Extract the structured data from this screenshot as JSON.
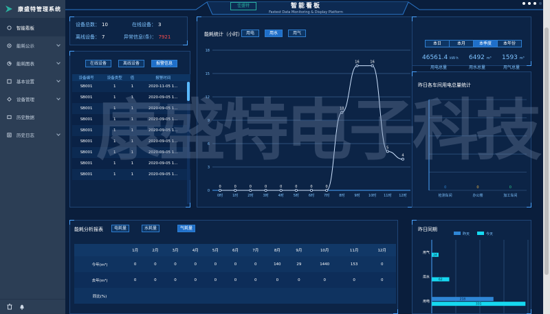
{
  "sidebar": {
    "logo_text": "康盛特管理系统",
    "items": [
      {
        "label": "智能看板",
        "icon": "dashboard-icon",
        "active": true
      },
      {
        "label": "能耗公示",
        "icon": "energy-icon"
      },
      {
        "label": "能耗图表",
        "icon": "chart-icon"
      },
      {
        "label": "基本设置",
        "icon": "settings-icon"
      },
      {
        "label": "设备管理",
        "icon": "device-icon"
      },
      {
        "label": "历史数据",
        "icon": "history-icon"
      },
      {
        "label": "历史日志",
        "icon": "log-icon"
      }
    ]
  },
  "header": {
    "title": "智能看板",
    "subtitle": "Fastest Data Monitoring & Display Platform",
    "logo_text": "佳盛特"
  },
  "device_stats": {
    "total_label": "设备总数：",
    "total_value": "10",
    "online_label": "在线设备：",
    "online_value": "3",
    "offline_label": "离线设备：",
    "offline_value": "7",
    "alarm_label": "异常信息(条)：",
    "alarm_value": "7921"
  },
  "device_panel": {
    "buttons": [
      "在线设备",
      "离线设备",
      "报警信息"
    ],
    "columns": [
      "设备编号",
      "设备类型",
      "值",
      "报警时间"
    ],
    "rows": [
      [
        "SB001",
        "1",
        "1",
        "2020-11-05 1..."
      ],
      [
        "SB001",
        "1",
        "1",
        "2020-09-05 1..."
      ],
      [
        "SB001",
        "1",
        "1",
        "2020-09-05 1..."
      ],
      [
        "SB001",
        "1",
        "1",
        "2020-09-05 1..."
      ],
      [
        "SB001",
        "1",
        "1",
        "2020-09-05 1..."
      ],
      [
        "SB001",
        "1",
        "1",
        "2020-09-05 1..."
      ],
      [
        "SB001",
        "1",
        "1",
        "2020-09-05 1..."
      ],
      [
        "SB001",
        "1",
        "1",
        "2020-09-05 1..."
      ],
      [
        "SB001",
        "1",
        "1",
        "2020-09-05 1..."
      ]
    ]
  },
  "energy_chart": {
    "title": "能耗统计（小时）",
    "tabs": [
      "用电",
      "用水",
      "用气"
    ]
  },
  "summary": {
    "tabs": [
      "本日",
      "本月",
      "本季度",
      "本年份"
    ],
    "items": [
      {
        "value": "46561.4",
        "unit": "kW·h",
        "label": "用电总量"
      },
      {
        "value": "6492",
        "unit": "m³",
        "label": "用水总量"
      },
      {
        "value": "1593",
        "unit": "m³",
        "label": "用气总量"
      }
    ]
  },
  "workshop_chart": {
    "title": "昨日各车间用电总量统计"
  },
  "energy_table": {
    "title": "能耗分析报表",
    "tabs": [
      "电耗量",
      "水耗量",
      "气耗量"
    ],
    "columns": [
      "",
      "1月",
      "2月",
      "3月",
      "4月",
      "5月",
      "6月",
      "7月",
      "8月",
      "9月",
      "10月",
      "11月",
      "12月"
    ],
    "rows": [
      [
        "今年(m³)",
        "0",
        "0",
        "0",
        "0",
        "0",
        "0",
        "0",
        "140",
        "29",
        "1440",
        "153",
        "0"
      ],
      [
        "去年(m³)",
        "0",
        "0",
        "0",
        "0",
        "0",
        "0",
        "0",
        "0",
        "0",
        "0",
        "0",
        "0"
      ],
      [
        "同比(%)",
        "",
        "",
        "",
        "",
        "",
        "",
        "",
        "",
        "",
        "",
        "",
        ""
      ]
    ]
  },
  "compare_chart": {
    "title": "昨日同期"
  },
  "watermark": "康盛特电子科技",
  "colors": {
    "accent": "#4aa3ff",
    "alarm": "#ff4d4d",
    "bar_yesterday": "#2f86d6",
    "bar_today": "#16d8f0",
    "grid": "#2c507c",
    "line": "#cfe4ff"
  },
  "chart_data": [
    {
      "type": "line",
      "title": "能耗统计（小时）",
      "x": [
        "0时",
        "1时",
        "2时",
        "3时",
        "4时",
        "5时",
        "6时",
        "7时",
        "8时",
        "9时",
        "10时",
        "11时",
        "12时"
      ],
      "values": [
        0,
        0,
        0,
        0,
        0,
        0,
        0,
        0,
        10,
        16,
        16,
        5,
        4
      ],
      "ylim": [
        0,
        18
      ],
      "yticks": [
        0,
        3,
        6,
        9,
        12,
        15,
        18
      ],
      "grid": true
    },
    {
      "type": "bar",
      "title": "昨日各车间用电总量统计",
      "categories": [
        "检测车间",
        "办公楼",
        "加工车间"
      ],
      "values": [
        0,
        0,
        0
      ],
      "value_colors": [
        "#2f86d6",
        "#f0b84a",
        "#2ad08a"
      ]
    },
    {
      "type": "bar",
      "title": "昨日同期",
      "orientation": "horizontal",
      "categories": [
        "用气",
        "用水",
        "用电"
      ],
      "series": [
        {
          "name": "昨天",
          "values": [
            0,
            0,
            218
          ]
        },
        {
          "name": "今天",
          "values": [
            24,
            62,
            331
          ]
        }
      ]
    }
  ]
}
